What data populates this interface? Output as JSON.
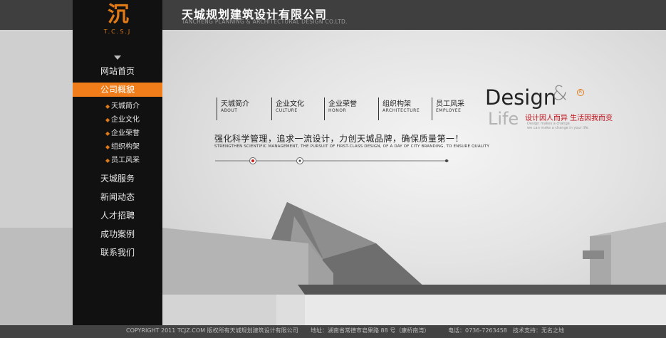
{
  "header": {
    "company_name": "天城规划建筑设计有限公司",
    "company_name_en": "TANCHENG PLANNING & ARCHITECTURAL DESIGN CO.LTD."
  },
  "logo": {
    "mark": "沉",
    "letters": "T.C.S.J"
  },
  "sidebar": {
    "items": [
      {
        "label": "网站首页"
      },
      {
        "label": "公司概貌"
      },
      {
        "label": "天城服务"
      },
      {
        "label": "新闻动态"
      },
      {
        "label": "人才招聘"
      },
      {
        "label": "成功案例"
      },
      {
        "label": "联系我们"
      }
    ],
    "sub_items": [
      {
        "label": "天城简介"
      },
      {
        "label": "企业文化"
      },
      {
        "label": "企业荣誉"
      },
      {
        "label": "组织构架"
      },
      {
        "label": "员工风采"
      }
    ],
    "active_index": 1
  },
  "main_nav": [
    {
      "cn": "天城简介",
      "en": "ABOUT"
    },
    {
      "cn": "企业文化",
      "en": "CULTURE"
    },
    {
      "cn": "企业荣誉",
      "en": "HONOR"
    },
    {
      "cn": "组织构架",
      "en": "ARCHITECTURE"
    },
    {
      "cn": "员工风采",
      "en": "EMPLOYEE"
    }
  ],
  "slogan": {
    "cn": "强化科学管理，追求一流设计，力创天城品牌，确保质量第一！",
    "en": "STRENGTHEN SCIENTIFIC MANAGEMENT, THE PURSUIT OF FIRST-CLASS DESIGN, OF A DAY OF CITY BRANDING, TO ENSURE QUALITY"
  },
  "design_life": {
    "design": "Design",
    "amp": "&",
    "life": "Life",
    "cn": "设计因人而异 生活因我而变",
    "small_line1": "Design makes a change",
    "small_line2": "we can make a change in your life",
    "reg": "R"
  },
  "footer": {
    "copyright": "COPYRIGHT 2011 TCJZ.COM 版权所有天城规划建筑设计有限公司",
    "address": "地址：湖南省常德市皂果路 88 号（康桥南湾）",
    "phone": "电话：0736-7263458",
    "support": "技术支持：无名之地"
  },
  "colors": {
    "accent": "#f07d1a",
    "sidebar_bg": "#111111",
    "topbar_bg": "#3f3f3f",
    "slogan_red": "#c0121a"
  }
}
